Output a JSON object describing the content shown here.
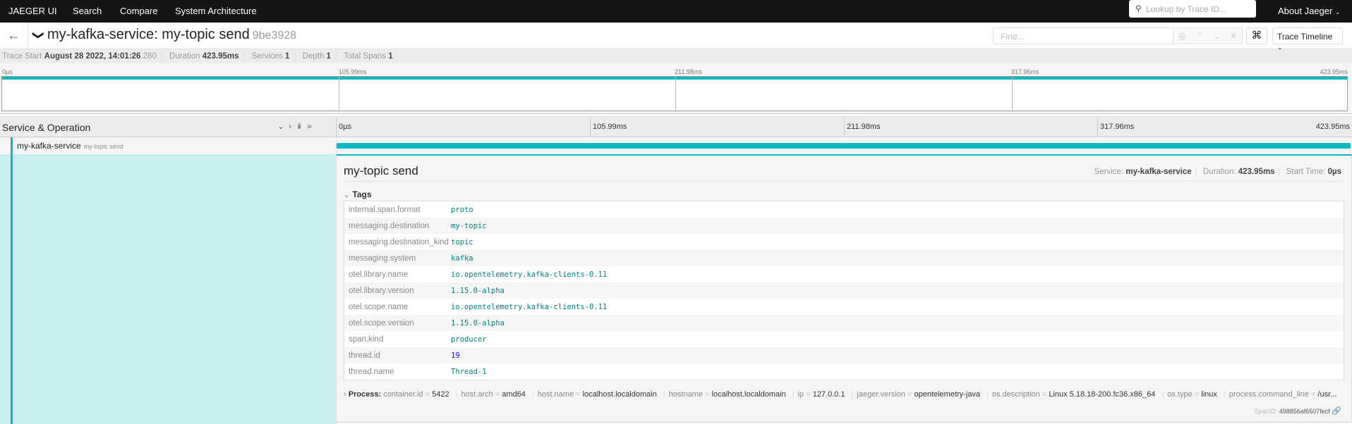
{
  "nav": {
    "brand": "JAEGER UI",
    "items": [
      "Search",
      "Compare",
      "System Architecture"
    ],
    "lookup_placeholder": "Lookup by Trace ID...",
    "about": "About Jaeger"
  },
  "trace": {
    "service": "my-kafka-service",
    "operation": "my-topic send",
    "title": "my-kafka-service: my-topic send",
    "trace_id": "9be3928",
    "find_placeholder": "Find...",
    "view": "Trace Timeline"
  },
  "summary": {
    "trace_start_label": "Trace Start",
    "trace_start_date": "August 28 2022, 14:01:26",
    "trace_start_ms": ".280",
    "duration_label": "Duration",
    "duration": "423.95ms",
    "services_label": "Services",
    "services": "1",
    "depth_label": "Depth",
    "depth": "1",
    "spans_label": "Total Spans",
    "spans": "1"
  },
  "ticks": [
    "0µs",
    "105.99ms",
    "211.98ms",
    "317.96ms",
    "423.95ms"
  ],
  "header": {
    "service_operation": "Service & Operation"
  },
  "span": {
    "service": "my-kafka-service",
    "operation": "my-topic send",
    "start_fraction": 0,
    "duration_fraction": 1
  },
  "detail": {
    "title": "my-topic send",
    "service_label": "Service:",
    "service": "my-kafka-service",
    "duration_label": "Duration:",
    "duration": "423.95ms",
    "start_label": "Start Time:",
    "start": "0µs",
    "tags_label": "Tags",
    "tags": [
      {
        "key": "internal.span.format",
        "value": "proto"
      },
      {
        "key": "messaging.destination",
        "value": "my-topic"
      },
      {
        "key": "messaging.destination_kind",
        "value": "topic"
      },
      {
        "key": "messaging.system",
        "value": "kafka"
      },
      {
        "key": "otel.library.name",
        "value": "io.opentelemetry.kafka-clients-0.11"
      },
      {
        "key": "otel.library.version",
        "value": "1.15.0-alpha"
      },
      {
        "key": "otel.scope.name",
        "value": "io.opentelemetry.kafka-clients-0.11"
      },
      {
        "key": "otel.scope.version",
        "value": "1.15.0-alpha"
      },
      {
        "key": "span.kind",
        "value": "producer"
      },
      {
        "key": "thread.id",
        "value": "19"
      },
      {
        "key": "thread.name",
        "value": "Thread-1"
      }
    ],
    "process_label": "Process:",
    "process": [
      {
        "key": "container.id",
        "value": "5422"
      },
      {
        "key": "host.arch",
        "value": "amd64"
      },
      {
        "key": "host.name",
        "value": "localhost.localdomain"
      },
      {
        "key": "hostname",
        "value": "localhost.localdomain"
      },
      {
        "key": "ip",
        "value": "127.0.0.1"
      },
      {
        "key": "jaeger.version",
        "value": "opentelemetry-java"
      },
      {
        "key": "os.description",
        "value": "Linux 5.18.18-200.fc36.x86_64"
      },
      {
        "key": "os.type",
        "value": "linux"
      },
      {
        "key": "process.command_line",
        "value": "/usr..."
      }
    ],
    "span_id_label": "SpanID:",
    "span_id": "498856af6507fecf"
  },
  "colors": {
    "accent": "#10b7bf",
    "detail_bg": "#c9eff0",
    "nav_bg": "#151515"
  }
}
